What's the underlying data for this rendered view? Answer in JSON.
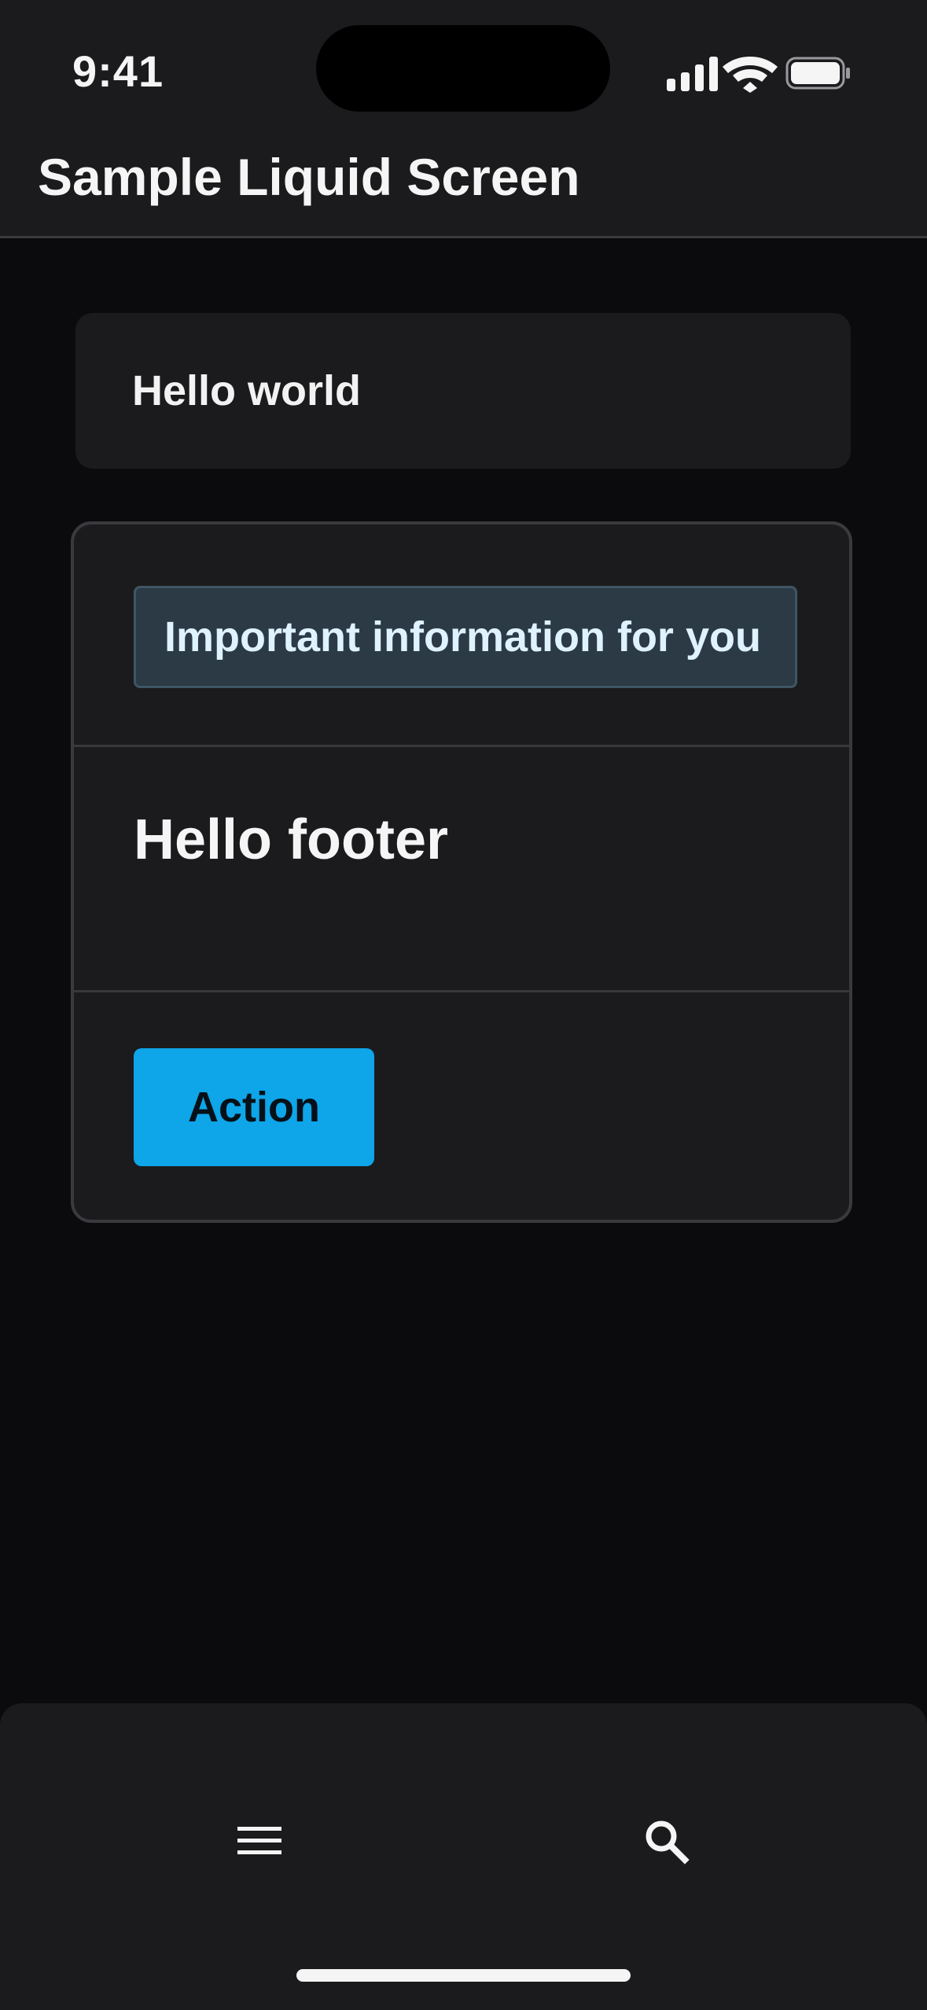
{
  "status_bar": {
    "time": "9:41",
    "icons": [
      "signal-icon",
      "wifi-icon",
      "battery-icon"
    ]
  },
  "header": {
    "title": "Sample Liquid Screen"
  },
  "card_primary": {
    "text": "Hello world"
  },
  "card_secondary": {
    "info_text": "Important information for you",
    "footer_text": "Hello footer",
    "action_label": "Action"
  },
  "bottom_nav": {
    "items": [
      {
        "icon": "menu-icon"
      },
      {
        "icon": "search-icon"
      }
    ]
  },
  "colors": {
    "background": "#0b0b0d",
    "surface": "#1b1b1d",
    "info_bg": "#2b3a44",
    "accent": "#0ea5e9"
  }
}
